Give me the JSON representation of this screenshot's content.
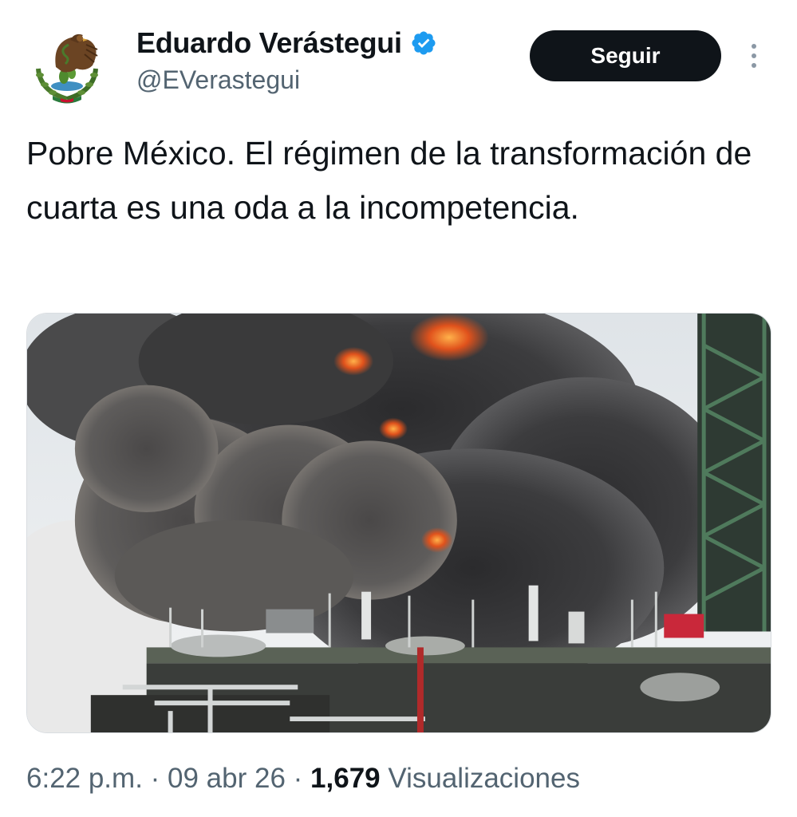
{
  "author": {
    "display_name": "Eduardo Verástegui",
    "handle": "@EVerastegui",
    "verified": true,
    "avatar_icon": "mexican-coat-of-arms-icon"
  },
  "actions": {
    "follow_label": "Seguir",
    "more_icon": "vertical-ellipsis-icon"
  },
  "tweet": {
    "text": "Pobre México. El régimen de la transformación de cuarta es una oda a la incompetencia."
  },
  "media": {
    "kind": "photo"
  },
  "meta": {
    "time": "6:22 p.m.",
    "separator": " · ",
    "date": "09 abr 26",
    "views_count": "1,679",
    "views_label": "Visualizaciones"
  },
  "colors": {
    "text_primary": "#0f1419",
    "text_secondary": "#536471",
    "verified_blue": "#1d9bf0",
    "follow_bg": "#0f1419"
  }
}
